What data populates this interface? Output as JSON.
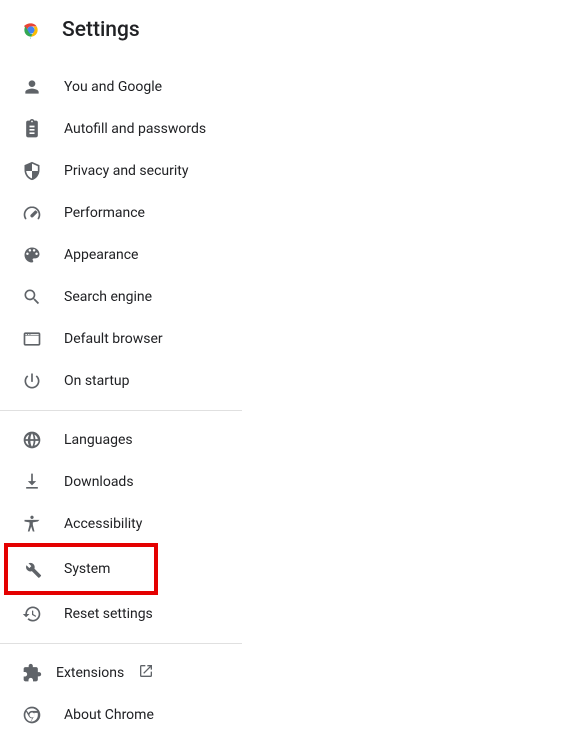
{
  "header": {
    "title": "Settings"
  },
  "sections": {
    "s1": {
      "items": [
        {
          "label": "You and Google"
        },
        {
          "label": "Autofill and passwords"
        },
        {
          "label": "Privacy and security"
        },
        {
          "label": "Performance"
        },
        {
          "label": "Appearance"
        },
        {
          "label": "Search engine"
        },
        {
          "label": "Default browser"
        },
        {
          "label": "On startup"
        }
      ]
    },
    "s2": {
      "items": [
        {
          "label": "Languages"
        },
        {
          "label": "Downloads"
        },
        {
          "label": "Accessibility"
        },
        {
          "label": "System"
        },
        {
          "label": "Reset settings"
        }
      ]
    },
    "s3": {
      "items": [
        {
          "label": "Extensions"
        },
        {
          "label": "About Chrome"
        }
      ]
    }
  }
}
